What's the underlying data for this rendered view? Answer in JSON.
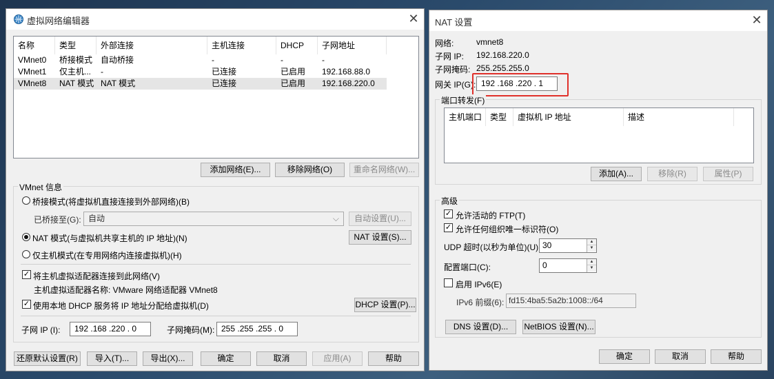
{
  "left_window": {
    "title": "虚拟网络编辑器",
    "table": {
      "columns": [
        "名称",
        "类型",
        "外部连接",
        "主机连接",
        "DHCP",
        "子网地址"
      ],
      "rows": [
        [
          "VMnet0",
          "桥接模式",
          "自动桥接",
          "-",
          "-",
          "-"
        ],
        [
          "VMnet1",
          "仅主机...",
          "-",
          "已连接",
          "已启用",
          "192.168.88.0"
        ],
        [
          "VMnet8",
          "NAT 模式",
          "NAT 模式",
          "已连接",
          "已启用",
          "192.168.220.0"
        ]
      ],
      "selected_row": 2
    },
    "buttons": {
      "add_network": "添加网络(E)...",
      "remove_network": "移除网络(O)",
      "rename_network": "重命名网络(W)..."
    },
    "vmnet_info": {
      "group_title": "VMnet 信息",
      "bridged_label": "桥接模式(将虚拟机直接连接到外部网络)(B)",
      "bridged_to_label": "已桥接至(G):",
      "bridged_to_value": "自动",
      "auto_settings": "自动设置(U)...",
      "nat_label": "NAT 模式(与虚拟机共享主机的 IP 地址)(N)",
      "nat_settings": "NAT 设置(S)...",
      "host_only_label": "仅主机模式(在专用网络内连接虚拟机)(H)",
      "connect_adapter_label": "将主机虚拟适配器连接到此网络(V)",
      "adapter_name_label": "主机虚拟适配器名称: VMware 网络适配器 VMnet8",
      "dhcp_label": "使用本地 DHCP 服务将 IP 地址分配给虚拟机(D)",
      "dhcp_settings": "DHCP 设置(P)...",
      "subnet_ip_label": "子网 IP (I):",
      "subnet_ip_value": "192 .168 .220 .  0",
      "subnet_mask_label": "子网掩码(M):",
      "subnet_mask_value": "255 .255 .255 .  0"
    },
    "footer": {
      "restore_defaults": "还原默认设置(R)",
      "import": "导入(T)...",
      "export": "导出(X)...",
      "ok": "确定",
      "cancel": "取消",
      "apply": "应用(A)",
      "help": "帮助"
    }
  },
  "right_window": {
    "title": "NAT 设置",
    "network_label": "网络:",
    "network_value": "vmnet8",
    "subnet_ip_label": "子网 IP:",
    "subnet_ip_value": "192.168.220.0",
    "subnet_mask_label": "子网掩码:",
    "subnet_mask_value": "255.255.255.0",
    "gateway_label": "网关 IP(G):",
    "gateway_value": "192 .168 .220 .  1",
    "port_forward": {
      "group_title": "端口转发(F)",
      "columns": [
        "主机端口",
        "类型",
        "虚拟机 IP 地址",
        "描述"
      ],
      "add": "添加(A)...",
      "remove": "移除(R)",
      "properties": "属性(P)"
    },
    "advanced": {
      "group_title": "高级",
      "active_ftp": "允许活动的 FTP(T)",
      "any_oui": "允许任何组织唯一标识符(O)",
      "udp_timeout_label": "UDP 超时(以秒为单位)(U):",
      "udp_timeout_value": "30",
      "config_port_label": "配置端口(C):",
      "config_port_value": "0",
      "enable_ipv6": "启用 IPv6(E)",
      "ipv6_prefix_label": "IPv6 前缀(6):",
      "ipv6_prefix_value": "fd15:4ba5:5a2b:1008::/64",
      "dns_settings": "DNS 设置(D)...",
      "netbios_settings": "NetBIOS 设置(N)..."
    },
    "footer": {
      "ok": "确定",
      "cancel": "取消",
      "help": "帮助"
    }
  },
  "colors": {
    "highlight": "#e0302a",
    "window_bg": "#f0f0f0",
    "selected_row": "#e5e5e5"
  }
}
